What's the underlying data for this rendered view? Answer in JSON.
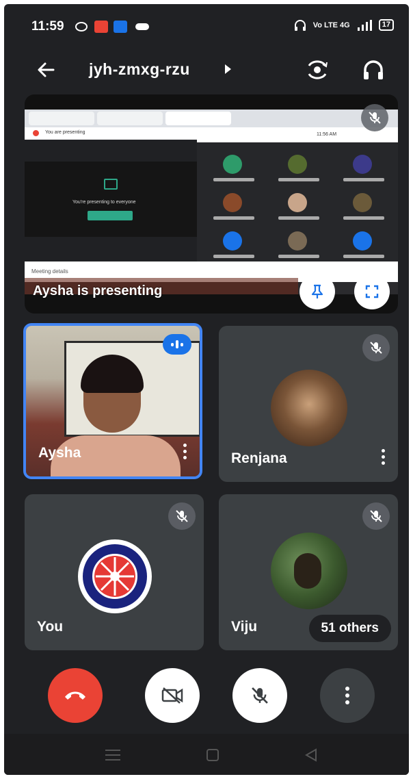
{
  "status_bar": {
    "time": "11:59",
    "right_text": "Vo LTE 4G",
    "battery": "17"
  },
  "app_bar": {
    "meeting_code": "jyh-zmxg-rzu"
  },
  "presentation": {
    "presenting_label": "Aysha is presenting",
    "screen": {
      "banner": "You are presenting",
      "panel_text": "You're presenting to everyone",
      "bottom_bar": "Meeting details",
      "time": "11:56 AM"
    }
  },
  "participants": [
    {
      "name": "Aysha",
      "speaking": true
    },
    {
      "name": "Renjana",
      "muted": true
    },
    {
      "name": "You",
      "muted": true
    },
    {
      "name": "Viju",
      "muted": true,
      "others": "51 others"
    }
  ],
  "colors": {
    "background": "#202124",
    "tile": "#3c4043",
    "accent": "#4285f4",
    "end_call": "#ea4335"
  },
  "icons": {
    "back": "back-arrow-icon",
    "switch_camera": "switch-camera-icon",
    "audio": "headphones-icon",
    "pin": "pin-icon",
    "fullscreen": "fullscreen-icon",
    "mic_off": "mic-off-icon",
    "end_call": "end-call-icon",
    "video_off": "video-off-icon",
    "more": "more-vert-icon"
  }
}
